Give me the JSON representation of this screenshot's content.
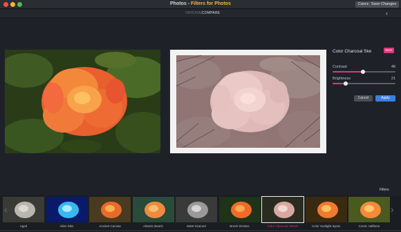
{
  "titlebar": {
    "app_name": "Photos",
    "separator": " - ",
    "extension_name": "Filters for Photos",
    "cancel_label": "Cancel",
    "save_label": "Save Changes"
  },
  "view_toggle": {
    "original_label": "ORIGINAL",
    "compare_label": "COMPARE",
    "active": "compare",
    "back_icon": "chevron-left-icon"
  },
  "panel": {
    "filter_name": "Color Charcoal Ske",
    "badge_label": "More",
    "sliders": [
      {
        "label": "Contrast",
        "value": "48",
        "fraction": 0.48
      },
      {
        "label": "Brightness",
        "value": "21",
        "fraction": 0.21
      }
    ],
    "cancel_label": "Cancel",
    "apply_label": "Apply"
  },
  "filters": {
    "button_label": "Filters",
    "items": [
      {
        "label": "Aged",
        "style": "aged"
      },
      {
        "label": "Alien Skin",
        "style": "alien"
      },
      {
        "label": "Ancient Canvas",
        "style": "canvas"
      },
      {
        "label": "Atlantic Beach",
        "style": "beach"
      },
      {
        "label": "B&W Grained",
        "style": "bw"
      },
      {
        "label": "Brush Strokes",
        "style": "brush"
      },
      {
        "label": "Color Charcoal Sketch",
        "style": "sketch",
        "selected": true
      },
      {
        "label": "Color Sunlight Spots",
        "style": "sunlight"
      },
      {
        "label": "Comic Halftone",
        "style": "comic"
      }
    ]
  },
  "colors": {
    "accent": "#e6337b",
    "apply": "#3b7fe0",
    "background": "#1e2228"
  }
}
